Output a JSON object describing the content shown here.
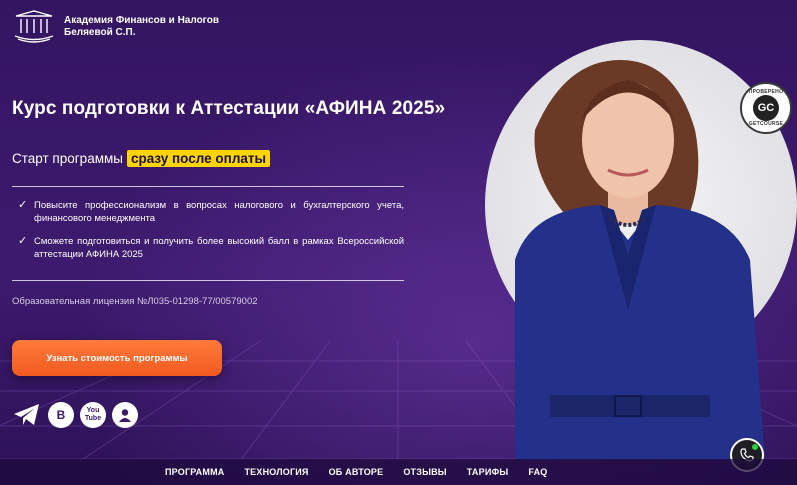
{
  "brand": {
    "name": "Академия Финансов и Налогов Беляевой С.П."
  },
  "hero": {
    "title": "Курс подготовки к Аттестации «АФИНА 2025»",
    "start_prefix": "Старт программы",
    "start_highlight": "сразу после оплаты",
    "benefits": [
      "Повысите профессионализм в вопросах налогового и бухгалтерского учета, финансового менеджмента",
      "Сможете подготовиться и получить более высокий балл в рамках Всероссийской аттестации АФИНА 2025"
    ],
    "license": "Образовательная лицензия №Л035-01298-77/00579002",
    "cta_label": "Узнать стоимость программы"
  },
  "badge": {
    "top_text": "ПРОВЕРЕНО",
    "logo_text": "GC",
    "bottom_text": "GETCOURSE"
  },
  "socials": [
    {
      "name": "telegram-icon",
      "glyph": ""
    },
    {
      "name": "vk-icon",
      "glyph": "В"
    },
    {
      "name": "youtube-icon",
      "glyph": "You Tube"
    },
    {
      "name": "profile-icon",
      "glyph": ""
    }
  ],
  "nav": {
    "items": [
      "ПРОГРАММА",
      "ТЕХНОЛОГИЯ",
      "ОБ АВТОРЕ",
      "ОТЗЫВЫ",
      "ТАРИФЫ",
      "FAQ"
    ]
  },
  "colors": {
    "background": "#3a1868",
    "accent_cta": "#f25a1f",
    "highlight": "#ffd400"
  }
}
